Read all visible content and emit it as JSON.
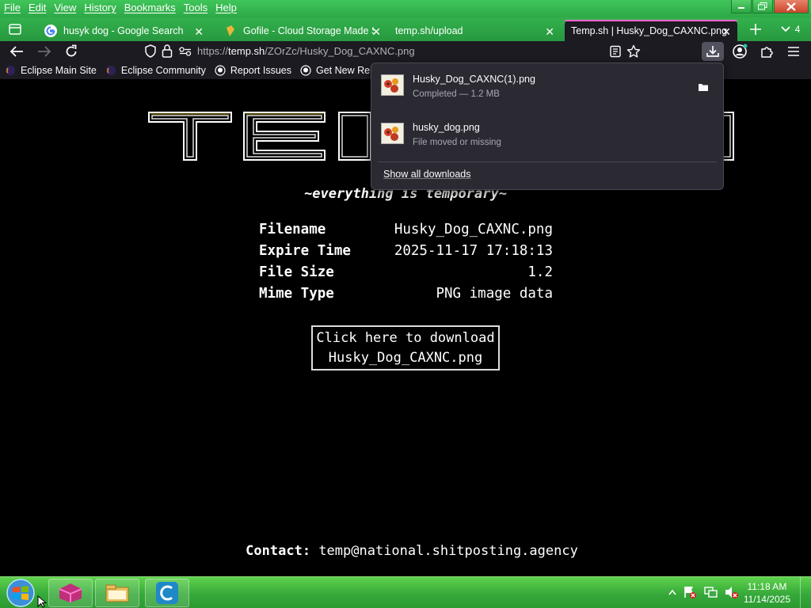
{
  "menubar": {
    "items": [
      "File",
      "Edit",
      "View",
      "History",
      "Bookmarks",
      "Tools",
      "Help"
    ]
  },
  "tabs": [
    {
      "label": "husyk dog - Google Search",
      "favicon": "google-icon",
      "active": false
    },
    {
      "label": "Gofile - Cloud Storage Made Sir",
      "favicon": "gofile-icon",
      "active": false
    },
    {
      "label": "temp.sh/upload",
      "favicon": "",
      "active": false
    },
    {
      "label": "Temp.sh | Husky_Dog_CAXNC.png",
      "favicon": "",
      "active": true
    }
  ],
  "tab_overflow_count": "4",
  "urlbar": {
    "prefix": "https://",
    "domain": "temp.sh",
    "path": "/ZOrZc/Husky_Dog_CAXNC.png"
  },
  "bookmarks": [
    {
      "label": "Eclipse Main Site",
      "icon": "eclipse-icon"
    },
    {
      "label": "Eclipse Community",
      "icon": "eclipse-icon"
    },
    {
      "label": "Report Issues",
      "icon": "github-icon"
    },
    {
      "label": "Get New Releases",
      "icon": "github-icon"
    }
  ],
  "page": {
    "logo_text": "TEMP",
    "tagline": "~everything is temporary~",
    "info": [
      {
        "label": "Filename",
        "value": "Husky_Dog_CAXNC.png"
      },
      {
        "label": "Expire Time",
        "value": "2025-11-17 17:18:13"
      },
      {
        "label": "File Size",
        "value": "1.2"
      },
      {
        "label": "Mime Type",
        "value": "PNG image data"
      }
    ],
    "download_line1": "Click here to download",
    "download_line2": "Husky_Dog_CAXNC.png",
    "contact_label": "Contact:",
    "contact_email": "temp@national.shitposting.agency"
  },
  "downloads_panel": {
    "items": [
      {
        "name": "Husky_Dog_CAXNC(1).png",
        "status": "Completed — 1.2 MB"
      },
      {
        "name": "husky_dog.png",
        "status": "File moved or missing"
      }
    ],
    "show_all": "Show all downloads"
  },
  "taskbar": {
    "time": "11:18 AM",
    "date": "11/14/2025"
  },
  "colors": {
    "titlebar_green": "#2ea847",
    "active_tab_accent": "#ff66cc",
    "page_background": "#000000",
    "panel_background": "#2b2a33"
  }
}
